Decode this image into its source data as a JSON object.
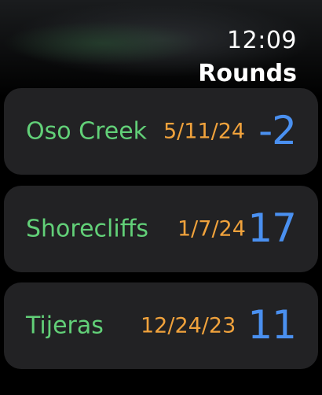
{
  "status": {
    "time": "12:09"
  },
  "header": {
    "title": "Rounds"
  },
  "rounds": [
    {
      "course": "Oso Creek",
      "date": "5/11/24",
      "score": "-2"
    },
    {
      "course": "Shorecliffs",
      "date": "1/7/24",
      "score": "17"
    },
    {
      "course": "Tijeras",
      "date": "12/24/23",
      "score": "11"
    }
  ],
  "colors": {
    "course": "#62d078",
    "date": "#f0a23c",
    "score": "#4a90f0",
    "card": "#222224"
  }
}
